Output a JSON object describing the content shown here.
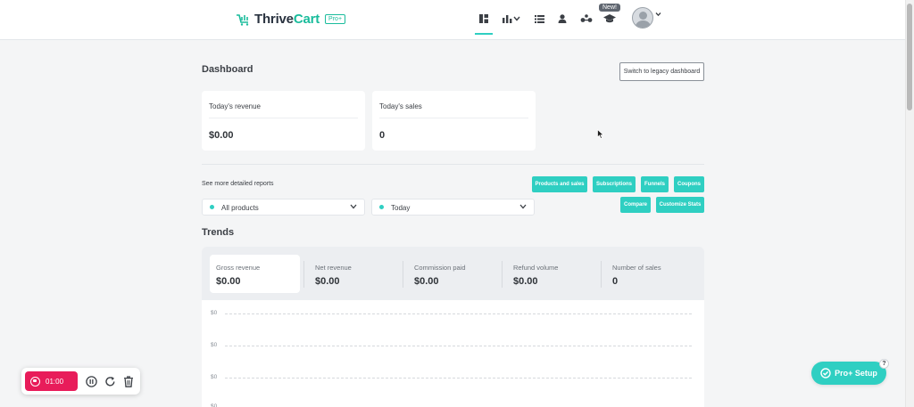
{
  "brand": {
    "name_part1": "Thrive",
    "name_part2": "Cart",
    "badge": "Pro+"
  },
  "nav": {
    "new_badge": "New!"
  },
  "dashboard": {
    "title": "Dashboard",
    "legacy_button": "Switch to legacy dashboard"
  },
  "stats": [
    {
      "label": "Today's revenue",
      "value": "$0.00"
    },
    {
      "label": "Today's sales",
      "value": "0"
    }
  ],
  "reports": {
    "label": "See more detailed reports",
    "buttons": [
      "Products and sales",
      "Subscriptions",
      "Funnels",
      "Coupons",
      "Compare",
      "Customize Stats"
    ]
  },
  "filters": {
    "products": "All products",
    "period": "Today"
  },
  "trends": {
    "title": "Trends",
    "tabs": [
      {
        "label": "Gross revenue",
        "value": "$0.00"
      },
      {
        "label": "Net revenue",
        "value": "$0.00"
      },
      {
        "label": "Commission paid",
        "value": "$0.00"
      },
      {
        "label": "Refund volume",
        "value": "$0.00"
      },
      {
        "label": "Number of sales",
        "value": "0"
      }
    ],
    "axis_labels": [
      "$0",
      "$0",
      "$0",
      "$0"
    ]
  },
  "recorder": {
    "time": "01:00"
  },
  "pro_setup": {
    "label": "Pro+ Setup",
    "badge": "?"
  },
  "colors": {
    "accent": "#2fcfc2",
    "record": "#e81c5a"
  }
}
